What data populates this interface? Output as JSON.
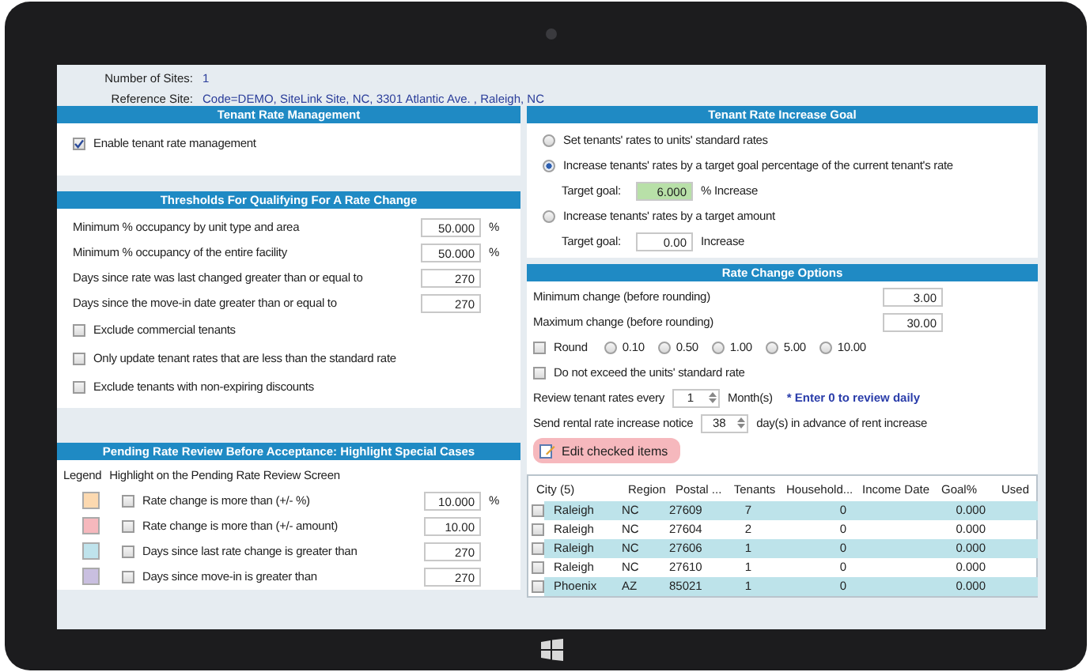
{
  "header": {
    "number_of_sites": {
      "label": "Number of Sites:",
      "value": "1"
    },
    "reference_site": {
      "label": "Reference Site:",
      "value": "Code=DEMO,  SiteLink Site, NC, 3301 Atlantic Ave. , Raleigh, NC"
    }
  },
  "tenant_rate_management": {
    "title": "Tenant Rate Management",
    "checkboxes": [
      {
        "label": "Enable tenant rate management",
        "checked": true
      }
    ]
  },
  "thresholds": {
    "title": "Thresholds For Qualifying For A Rate Change",
    "fields": [
      {
        "label": "Minimum % occupancy by unit type and area",
        "value": "50.000",
        "unit": "%"
      },
      {
        "label": "Minimum % occupancy of the entire facility",
        "value": "50.000",
        "unit": "%"
      },
      {
        "label": "Days since rate was last changed greater than or equal to",
        "value": "270"
      },
      {
        "label": "Days since the move-in date greater than or equal to",
        "value": "270"
      }
    ],
    "checkboxes": [
      {
        "label": "Exclude commercial tenants",
        "checked": false
      },
      {
        "label": "Only update tenant rates that are less than the standard rate",
        "checked": false
      },
      {
        "label": "Exclude tenants with non-expiring discounts",
        "checked": false
      }
    ]
  },
  "pending_review": {
    "title": "Pending Rate Review Before Acceptance:  Highlight Special Cases",
    "legend_label": "Legend",
    "highlight_label": "Highlight on the Pending Rate Review Screen",
    "rows": [
      {
        "color": "#fcd9b0",
        "label": "Rate change is more than (+/- %)",
        "checked": false,
        "value": "10.000",
        "unit": "%"
      },
      {
        "color": "#f6b8bd",
        "label": "Rate change is more than (+/- amount)",
        "checked": false,
        "value": "10.00"
      },
      {
        "color": "#bfe3ec",
        "label": "Days since last rate change is greater than",
        "checked": false,
        "value": "270"
      },
      {
        "color": "#c9bfe0",
        "label": "Days since move-in is greater than",
        "checked": false,
        "value": "270"
      }
    ]
  },
  "increase_goal": {
    "title": "Tenant Rate Increase Goal",
    "options": [
      {
        "label": "Set tenants' rates to units' standard rates",
        "selected": false
      },
      {
        "label": "Increase tenants' rates by a target goal percentage of the current tenant's rate",
        "selected": true,
        "target": {
          "label": "Target goal:",
          "value": "6.000",
          "unit": "% Increase"
        }
      },
      {
        "label": "Increase tenants' rates by a target amount",
        "selected": false,
        "target": {
          "label": "Target goal:",
          "value": "0.00",
          "unit": "Increase"
        }
      }
    ]
  },
  "rate_change_options": {
    "title": "Rate Change Options",
    "fields": [
      {
        "label": "Minimum change (before rounding)",
        "value": "3.00"
      },
      {
        "label": "Maximum change (before rounding)",
        "value": "30.00"
      }
    ],
    "round": {
      "label": "Round",
      "checked": false,
      "choices": [
        {
          "label": "0.10",
          "selected": false
        },
        {
          "label": "0.50",
          "selected": false
        },
        {
          "label": "1.00",
          "selected": false
        },
        {
          "label": "5.00",
          "selected": false
        },
        {
          "label": "10.00",
          "selected": false
        }
      ]
    },
    "do_not_exceed": {
      "label": "Do not exceed the units' standard rate",
      "checked": false
    },
    "review": {
      "label": "Review tenant rates every",
      "value": "1",
      "unit": "Month(s)",
      "note": "* Enter 0 to review daily"
    },
    "notice": {
      "label": "Send rental rate increase notice",
      "value": "38",
      "unit": "day(s) in advance of rent increase"
    },
    "edit_button": {
      "label": "Edit checked items"
    }
  },
  "grid": {
    "columns": [
      "City (5)",
      "Region",
      "Postal ...",
      "Tenants",
      "Household...",
      "Income Date",
      "Goal%",
      "Used"
    ],
    "rows": [
      {
        "checked": false,
        "cells": [
          "Raleigh",
          "NC",
          "27609",
          "7",
          "0",
          "",
          "0.000",
          ""
        ]
      },
      {
        "checked": false,
        "cells": [
          "Raleigh",
          "NC",
          "27604",
          "2",
          "0",
          "",
          "0.000",
          ""
        ]
      },
      {
        "checked": false,
        "cells": [
          "Raleigh",
          "NC",
          "27606",
          "1",
          "0",
          "",
          "0.000",
          ""
        ]
      },
      {
        "checked": false,
        "cells": [
          "Raleigh",
          "NC",
          "27610",
          "1",
          "0",
          "",
          "0.000",
          ""
        ]
      },
      {
        "checked": false,
        "cells": [
          "Phoenix",
          "AZ",
          "85021",
          "1",
          "0",
          "",
          "0.000",
          ""
        ]
      }
    ]
  }
}
